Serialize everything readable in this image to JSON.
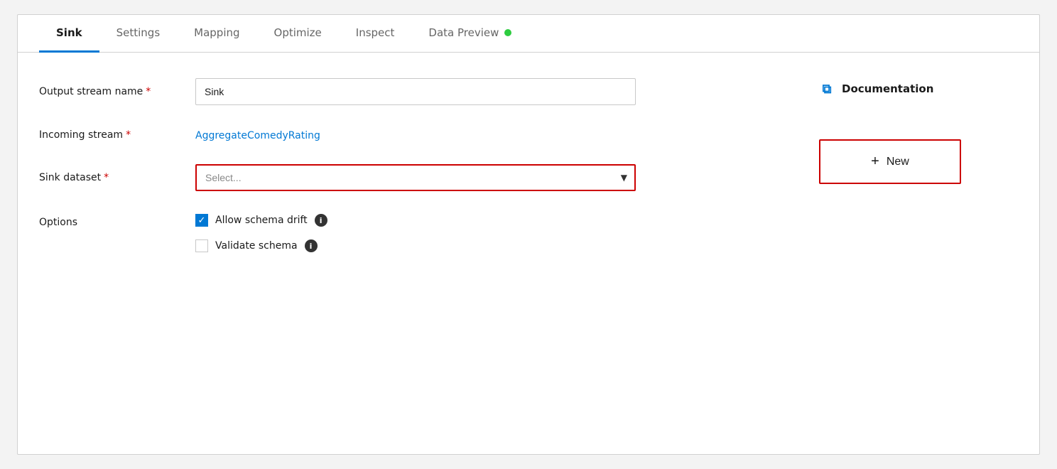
{
  "tabs": [
    {
      "id": "sink",
      "label": "Sink",
      "active": true
    },
    {
      "id": "settings",
      "label": "Settings",
      "active": false
    },
    {
      "id": "mapping",
      "label": "Mapping",
      "active": false
    },
    {
      "id": "optimize",
      "label": "Optimize",
      "active": false
    },
    {
      "id": "inspect",
      "label": "Inspect",
      "active": false
    },
    {
      "id": "data-preview",
      "label": "Data Preview",
      "active": false
    }
  ],
  "form": {
    "output_stream_label": "Output stream name",
    "output_stream_required": "*",
    "output_stream_value": "Sink",
    "incoming_stream_label": "Incoming stream",
    "incoming_stream_required": "*",
    "incoming_stream_value": "AggregateComedyRating",
    "sink_dataset_label": "Sink dataset",
    "sink_dataset_required": "*",
    "sink_dataset_placeholder": "Select...",
    "options_label": "Options",
    "allow_schema_drift_label": "Allow schema drift",
    "validate_schema_label": "Validate schema",
    "allow_schema_drift_checked": true,
    "validate_schema_checked": false
  },
  "side": {
    "doc_label": "Documentation",
    "new_label": "New",
    "plus_icon": "+"
  },
  "icons": {
    "external_link": "⧉",
    "checkmark": "✓",
    "info": "i",
    "dropdown_arrow": "▼"
  }
}
